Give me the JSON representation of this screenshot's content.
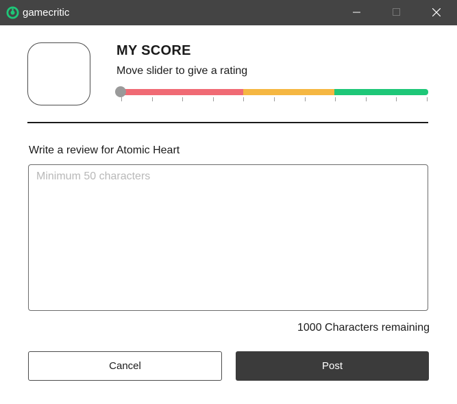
{
  "window": {
    "title": "gamecritic",
    "logo_icon": "gamecritic-logo-icon",
    "controls": [
      "minimize-icon",
      "maximize-icon",
      "close-icon"
    ]
  },
  "score": {
    "heading": "MY SCORE",
    "instruction": "Move slider to give a rating",
    "slider": {
      "value": 0,
      "segment_colors": [
        "#f06a74",
        "#f5b742",
        "#1ec778"
      ],
      "thumb_color": "#9a9a9a",
      "tick_count": 11
    }
  },
  "review": {
    "label": "Write a review for Atomic Heart",
    "value": "",
    "placeholder": "Minimum 50 characters",
    "chars_remaining": "1000 Characters remaining"
  },
  "actions": {
    "cancel_label": "Cancel",
    "post_label": "Post"
  },
  "colors": {
    "titlebar": "#444444",
    "accent_green": "#1ec778",
    "post_button": "#3b3b3b"
  }
}
